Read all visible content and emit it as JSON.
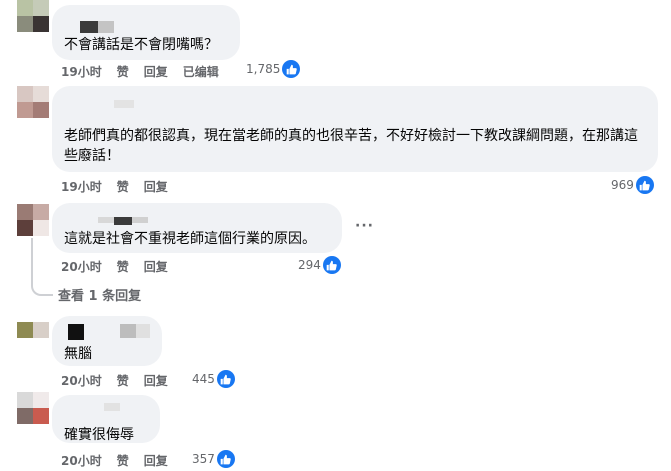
{
  "comments": [
    {
      "text": "不會講話是不會閉嘴嗎？",
      "time": "19小时",
      "like_label": "赞",
      "reply_label": "回复",
      "edited_label": "已编辑",
      "reactions": "1,785"
    },
    {
      "text": "老師們真的都很認真，現在當老師的真的也很辛苦，不好好檢討一下教改課綱問題，在那講這些廢話！",
      "time": "19小时",
      "like_label": "赞",
      "reply_label": "回复",
      "reactions": "969"
    },
    {
      "text": "這就是社會不重視老師這個行業的原因。",
      "time": "20小时",
      "like_label": "赞",
      "reply_label": "回复",
      "reactions": "294",
      "more_label": "···",
      "view_replies": "查看 1 条回复"
    },
    {
      "text": "無腦",
      "time": "20小时",
      "like_label": "赞",
      "reply_label": "回复",
      "reactions": "445"
    },
    {
      "text": "確實很侮辱",
      "time": "20小时",
      "like_label": "赞",
      "reply_label": "回复",
      "reactions": "357"
    }
  ],
  "colors": {
    "bubble": "#f0f2f5",
    "meta": "#65676b",
    "like": "#1877f2"
  }
}
